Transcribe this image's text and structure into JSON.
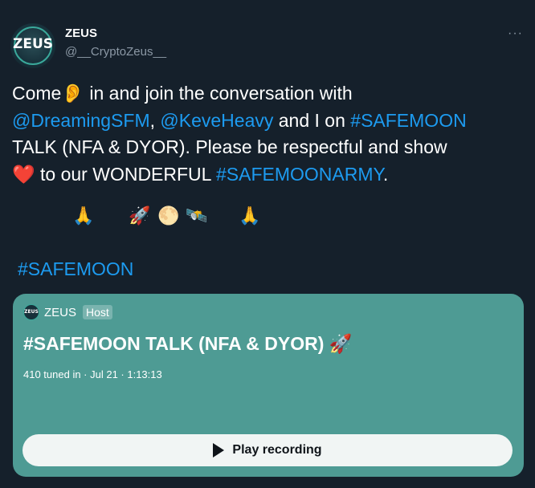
{
  "author": {
    "name": "ZEUS",
    "handle": "@__CryptoZeus__",
    "avatar_text": "ZEUS"
  },
  "tweet": {
    "text_1": "Come",
    "emoji_ear": "👂",
    "text_2": " in and join the conversation with ",
    "mention_1": "@DreamingSFM",
    "text_3": ", ",
    "mention_2": "@KeveHeavy",
    "text_4": " and I on ",
    "hashtag_1": "#SAFEMOON",
    "text_5": " TALK (NFA & DYOR). Please be respectful and show ",
    "emoji_heart": "❤️",
    "text_6": " to our WONDERFUL ",
    "hashtag_2": "#SAFEMOONARMY",
    "text_7": ".",
    "emoji_row": {
      "pray_left": "🙏",
      "rocket": "🚀",
      "moon": "🌕",
      "satellite": "🛰️",
      "pray_right": "🙏"
    },
    "hashtag_footer": "#SAFEMOON"
  },
  "space_card": {
    "host_name": "ZEUS",
    "host_badge": "Host",
    "title": "#SAFEMOON TALK (NFA & DYOR) 🚀",
    "meta": "410 tuned in · Jul 21 · 1:13:13",
    "play_label": "Play recording"
  },
  "more_label": "···",
  "colors": {
    "background": "#15202b",
    "link": "#1d9bf0",
    "card": "#4e9b94"
  }
}
